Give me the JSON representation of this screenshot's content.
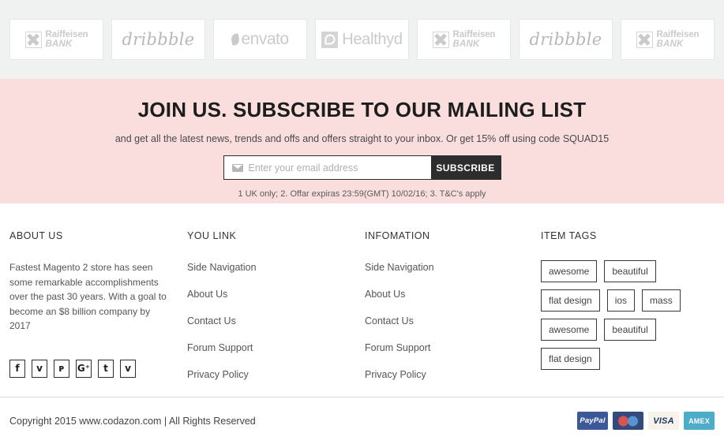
{
  "brands": [
    {
      "name": "Raiffeisen BANK",
      "type": "raiffeisen",
      "line1": "Raiffeisen",
      "line2": "BANK"
    },
    {
      "name": "dribbble",
      "type": "dribbble",
      "text": "dribbble"
    },
    {
      "name": "envato",
      "type": "envato",
      "text": "envato"
    },
    {
      "name": "Healthyd",
      "type": "healthyd",
      "text": "Healthyd"
    },
    {
      "name": "Raiffeisen BANK",
      "type": "raiffeisen",
      "line1": "Raiffeisen",
      "line2": "BANK"
    },
    {
      "name": "dribbble",
      "type": "dribbble",
      "text": "dribbble"
    },
    {
      "name": "Raiffeisen BANK",
      "type": "raiffeisen",
      "line1": "Raiffeisen",
      "line2": "BANK"
    }
  ],
  "newsletter": {
    "title": "JOIN US. SUBSCRIBE TO OUR MAILING LIST",
    "subtitle": "and get all the latest news, trends and offs and offers straight to your inbox. Or get 15% off using code SQUAD15",
    "placeholder": "Enter your email address",
    "input_value": "",
    "submit_label": "SUBSCRIBE",
    "fine_print": "1 UK only; 2. Offar expiras 23:59(GMT) 10/02/16; 3. T&C's apply",
    "background_color": "#fadddd",
    "button_color": "#2d2d2d"
  },
  "footer": {
    "about": {
      "heading": "ABOUT US",
      "text": "Fastest Magento 2 store has seen some remarkable accomplishments over the past 30 years. With a goal to become an $8 billion company by 2017",
      "socials": [
        {
          "name": "facebook",
          "glyph": "f"
        },
        {
          "name": "twitter",
          "glyph": "ᴠ"
        },
        {
          "name": "pinterest",
          "glyph": "ᴘ"
        },
        {
          "name": "google-plus",
          "glyph": "G⁺"
        },
        {
          "name": "tumblr",
          "glyph": "t"
        },
        {
          "name": "vimeo",
          "glyph": "v"
        }
      ]
    },
    "you_link": {
      "heading": "YOU LINK",
      "items": [
        "Side Navigation",
        "About Us",
        "Contact Us",
        "Forum Support",
        "Privacy Policy"
      ]
    },
    "infomation": {
      "heading": "INFOMATION",
      "items": [
        "Side Navigation",
        "About Us",
        "Contact Us",
        "Forum Support",
        "Privacy Policy"
      ]
    },
    "item_tags": {
      "heading": "ITEM TAGS",
      "tags": [
        "awesome",
        "beautiful",
        "flat design",
        "ios",
        "mass",
        "awesome",
        "beautiful",
        "flat design"
      ]
    }
  },
  "bottom": {
    "copyright": "Copyright 2015 www.codazon.com | All Rights Reserved",
    "payments": [
      {
        "name": "paypal",
        "label": "PayPal",
        "color": "#3b5998"
      },
      {
        "name": "maestro",
        "label": "",
        "color": "#324a7e"
      },
      {
        "name": "visa",
        "label": "VISA",
        "color": "#f7f3ea"
      },
      {
        "name": "amex",
        "label": "AMEX",
        "color": "#4cacc9"
      }
    ]
  }
}
